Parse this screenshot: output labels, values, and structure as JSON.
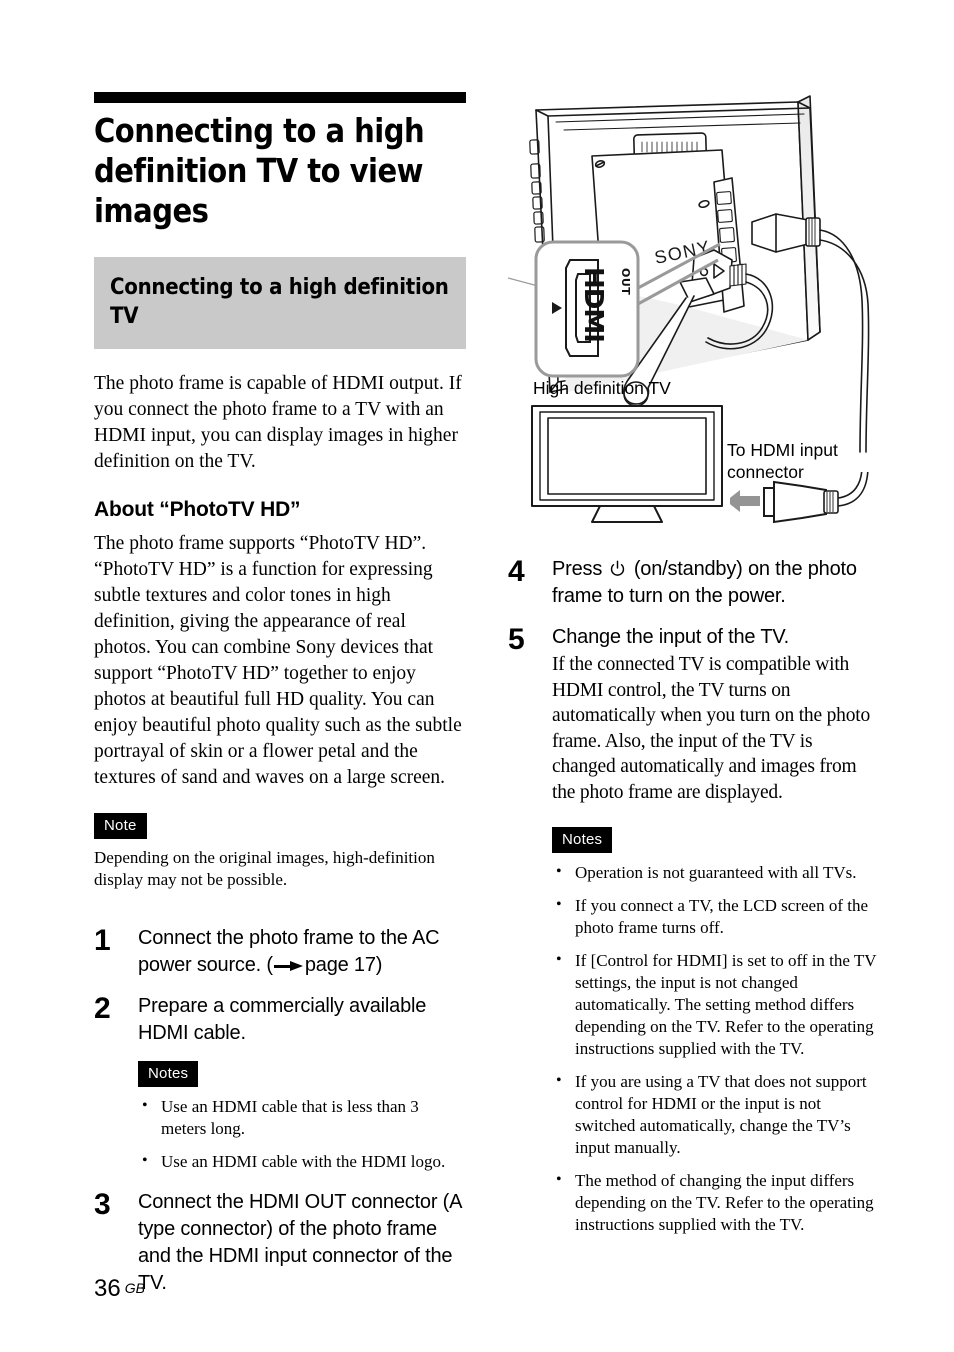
{
  "page": {
    "folio_number": "36",
    "folio_region": "GB"
  },
  "chapter": {
    "title": "Connecting to a high definition TV to view images"
  },
  "section": {
    "banner_title": "Connecting to a high definition TV",
    "intro": "The photo frame is capable of HDMI output. If you connect the photo frame to a TV with an HDMI input, you can display images in higher definition on the TV."
  },
  "about": {
    "heading": "About “PhotoTV HD”",
    "body": "The photo frame supports “PhotoTV HD”. “PhotoTV HD” is a function for expressing subtle textures and color tones in high definition, giving the appearance of real photos. You can combine Sony devices that support “PhotoTV HD” together to enjoy photos at beautiful full HD quality. You can enjoy beautiful photo quality such as the subtle portrayal of skin or a flower petal and the textures of sand and waves on a large screen.",
    "note_badge": "Note",
    "note_text": "Depending on the original images, high-definition display may not be possible."
  },
  "steps_left": [
    {
      "number": "1",
      "text_before": "Connect the photo frame to the AC power source. (",
      "text_after": "page 17)"
    },
    {
      "number": "2",
      "text": "Prepare a commercially available HDMI cable."
    },
    {
      "number": "3",
      "text": "Connect the HDMI OUT connector (A type connector) of the photo frame and the HDMI input connector of the TV."
    }
  ],
  "notes_step2": {
    "badge": "Notes",
    "items": [
      "Use an HDMI cable that is less than 3 meters long.",
      "Use an HDMI cable with the HDMI logo."
    ]
  },
  "figure": {
    "caption_hdtv": "High definition TV",
    "caption_hdmi_input": "To HDMI input connector",
    "brand_label": "SONY",
    "port_label": "HDMI",
    "port_direction": "OUT"
  },
  "steps_right": [
    {
      "number": "4",
      "text_before": "Press ",
      "text_after": " (on/standby) on the photo frame to turn on the power."
    },
    {
      "number": "5",
      "text": "Change the input of the TV.",
      "sub": "If the connected TV is compatible with HDMI control, the TV turns on automatically when you turn on the photo frame. Also, the input of the TV is changed automatically and images from the photo frame are displayed."
    }
  ],
  "notes_step5": {
    "badge": "Notes",
    "items": [
      "Operation is not guaranteed with all TVs.",
      "If you connect a TV, the LCD screen of the photo frame turns off.",
      "If [Control for HDMI] is set to off in the TV settings, the input is not changed automatically. The setting method differs depending on the TV. Refer to the operating instructions supplied with the TV.",
      "If you are using a TV that does not support control for HDMI or the input is not switched automatically, change the TV’s input manually.",
      "The method of changing the input differs depending on the TV. Refer to the operating instructions supplied with the TV."
    ]
  },
  "colors": {
    "banner_gray": "#c9c9c9",
    "badge_black": "#000000",
    "ink": "#000000"
  }
}
